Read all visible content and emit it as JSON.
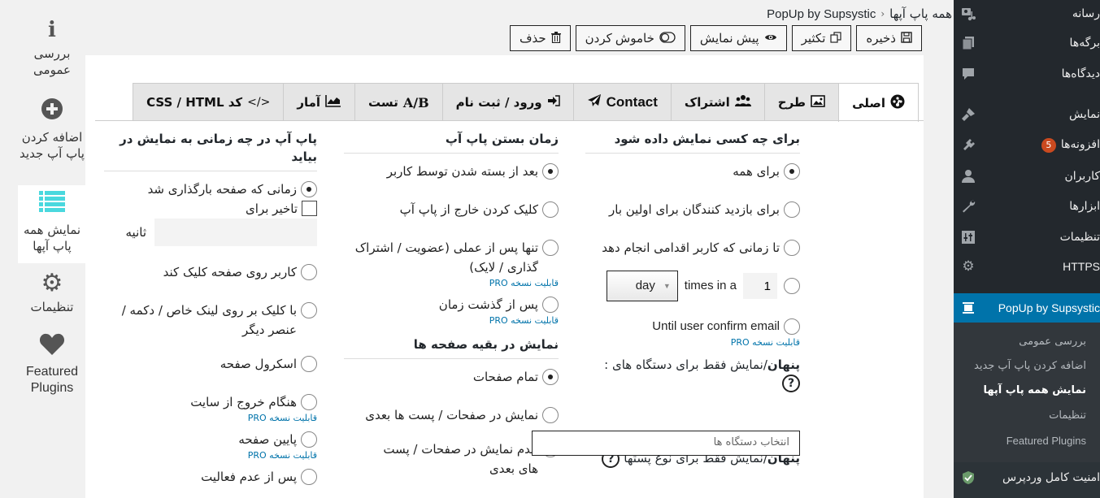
{
  "admin_menu": {
    "items": [
      {
        "label": "رسانه",
        "icon": "media-icon"
      },
      {
        "label": "برگه‌ها",
        "icon": "pages-icon"
      },
      {
        "label": "دیدگاه‌ها",
        "icon": "comments-icon"
      },
      {
        "label": "نمایش",
        "icon": "appearance-icon"
      },
      {
        "label": "افزونه‌ها",
        "icon": "plugins-icon",
        "badge": "5"
      },
      {
        "label": "کاربران",
        "icon": "users-icon"
      },
      {
        "label": "ابزارها",
        "icon": "tools-icon"
      },
      {
        "label": "تنظیمات",
        "icon": "settings-icon"
      },
      {
        "label": "HTTPS",
        "icon": "gear-icon"
      },
      {
        "label": "PopUp by Supsystic",
        "icon": "popup-icon",
        "current": true
      }
    ],
    "submenu": [
      {
        "label": "بررسی عمومی"
      },
      {
        "label": "اضافه کردن پاپ آپ جدید"
      },
      {
        "label": "نمایش همه پاپ آپها",
        "active": true
      },
      {
        "label": "تنظیمات"
      },
      {
        "label": "Featured Plugins"
      }
    ],
    "bottom_item": {
      "label": "امنیت کامل وردپرس",
      "icon": "shield-icon"
    },
    "colors": {
      "background": "#23282d",
      "current": "#0073aa",
      "badge": "#ca4a1f"
    }
  },
  "breadcrumb": {
    "root": "همه پاپ آپها",
    "separator": "‹",
    "current": "PopUp by Supsystic"
  },
  "toolbar": {
    "save": "ذخیره",
    "duplicate": "تکثیر",
    "preview": "پیش نمایش",
    "disable": "خاموش کردن",
    "delete": "حذف"
  },
  "plugin_nav": [
    {
      "label": "بررسی عمومی",
      "icon": "info-icon"
    },
    {
      "label": "اضافه کردن پاپ آپ جدید",
      "icon": "plus-circle-icon"
    },
    {
      "label": "نمایش همه پاپ آپها",
      "icon": "list-icon",
      "active": true
    },
    {
      "label": "تنظیمات",
      "icon": "gear-icon"
    },
    {
      "label": "Featured Plugins",
      "icon": "heart-icon"
    }
  ],
  "tabs": [
    {
      "label": "اصلی",
      "icon": "dashboard-icon",
      "active": true
    },
    {
      "label": "طرح",
      "icon": "image-icon"
    },
    {
      "label": "اشتراک",
      "icon": "users-icon"
    },
    {
      "label": "Contact",
      "icon": "paper-plane-icon"
    },
    {
      "label": "ورود / ثبت نام",
      "icon": "sign-in-icon"
    },
    {
      "label": "تست",
      "prefix": "A/B"
    },
    {
      "label": "آمار",
      "icon": "line-chart-icon"
    },
    {
      "label": "کد CSS / HTML",
      "icon": "code-icon"
    }
  ],
  "who_column": {
    "title": "برای چه کسی نمایش داده شود",
    "options": [
      {
        "label": "برای همه",
        "checked": true
      },
      {
        "label": "برای بازدید کنندگان برای اولین بار",
        "checked": false
      },
      {
        "label": "تا زمانی که کاربر اقدامی انجام دهد",
        "checked": false
      }
    ],
    "times": {
      "value": "1",
      "text": "times in a",
      "period": "day",
      "checked": false
    },
    "confirm_email": {
      "label": "Until user confirm email",
      "checked": false,
      "pro": "قابلیت نسخه PRO"
    },
    "devices_label_bold": "پنهان",
    "devices_label": "/نمایش فقط برای دستگاه های :",
    "devices_placeholder": "انتخاب دستگاه ها",
    "post_types_label_bold": "پنهان",
    "post_types_label": "/نمایش فقط برای نوع پستها",
    "help": "?"
  },
  "close_column": {
    "title": "زمان بستن پاپ آپ",
    "options": [
      {
        "label": "بعد از بسته شدن توسط کاربر",
        "checked": true
      },
      {
        "label": "کلیک کردن خارج از پاپ آپ",
        "checked": false
      },
      {
        "label": "تنها پس از عملی (عضویت / اشتراک گذاری / لایک)",
        "checked": false,
        "pro": "قابلیت نسخه PRO"
      },
      {
        "label": "پس از گذشت زمان",
        "checked": false,
        "pro": "قابلیت نسخه PRO"
      }
    ]
  },
  "pages_column": {
    "title": "نمایش در بقیه صفحه ها",
    "options": [
      {
        "label": "تمام صفحات",
        "checked": true
      },
      {
        "label": "نمایش در صفحات / پست ها بعدی",
        "checked": false
      },
      {
        "label": "عدم نمایش در صفحات / پست های بعدی",
        "checked": false
      }
    ]
  },
  "when_column": {
    "title": "پاپ آپ در چه زمانی به نمایش در بیاید",
    "options": [
      {
        "label": "زمانی که صفحه بارگذاری شد",
        "checked": true
      },
      {
        "label": "کاربر روی صفحه کلیک کند",
        "checked": false
      },
      {
        "label": "با کلیک بر روی لینک خاص / دکمه / عنصر دیگر",
        "checked": false
      },
      {
        "label": "اسکرول صفحه",
        "checked": false
      },
      {
        "label": "هنگام خروج از سایت",
        "checked": false,
        "pro": "قابلیت نسخه PRO"
      },
      {
        "label": "پایین صفحه",
        "checked": false,
        "pro": "قابلیت نسخه PRO"
      },
      {
        "label": "پس از عدم فعالیت",
        "checked": false
      }
    ],
    "delay_label": "تاخیر برای",
    "delay_checked": false,
    "seconds_label": "ثانیه",
    "seconds_value": ""
  }
}
